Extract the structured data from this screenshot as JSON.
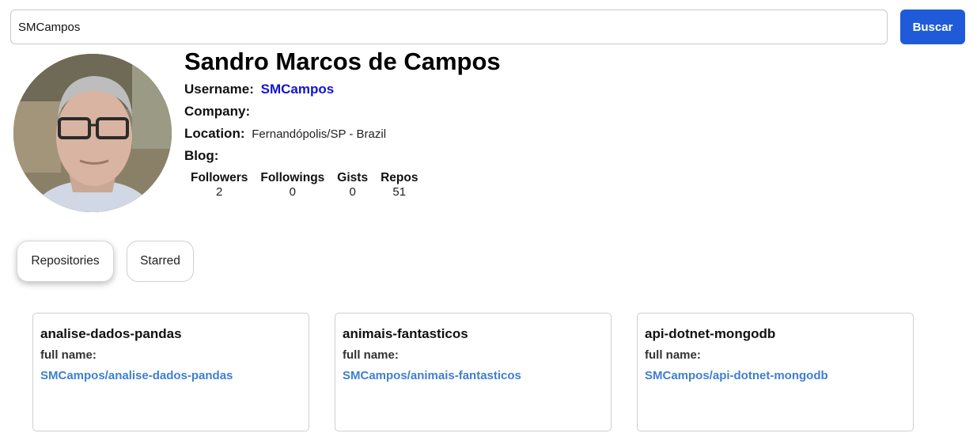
{
  "search": {
    "value": "SMCampos",
    "placeholder": "",
    "button_label": "Buscar"
  },
  "profile": {
    "name": "Sandro Marcos de Campos",
    "username_label": "Username:",
    "username": "SMCampos",
    "company_label": "Company:",
    "company": "",
    "location_label": "Location:",
    "location": "Fernandópolis/SP - Brazil",
    "blog_label": "Blog:",
    "blog": ""
  },
  "stats": [
    {
      "label": "Followers",
      "value": "2"
    },
    {
      "label": "Followings",
      "value": "0"
    },
    {
      "label": "Gists",
      "value": "0"
    },
    {
      "label": "Repos",
      "value": "51"
    }
  ],
  "tabs": [
    {
      "label": "Repositories",
      "active": true
    },
    {
      "label": "Starred",
      "active": false
    }
  ],
  "repos": [
    {
      "name": "analise-dados-pandas",
      "full_name_label": "full name:",
      "full_name": "SMCampos/analise-dados-pandas"
    },
    {
      "name": "animais-fantasticos",
      "full_name_label": "full name:",
      "full_name": "SMCampos/animais-fantasticos"
    },
    {
      "name": "api-dotnet-mongodb",
      "full_name_label": "full name:",
      "full_name": "SMCampos/api-dotnet-mongodb"
    }
  ],
  "colors": {
    "button": "#1f5bd8",
    "username_link": "#1212d6",
    "repo_link": "#3f7fd0"
  }
}
